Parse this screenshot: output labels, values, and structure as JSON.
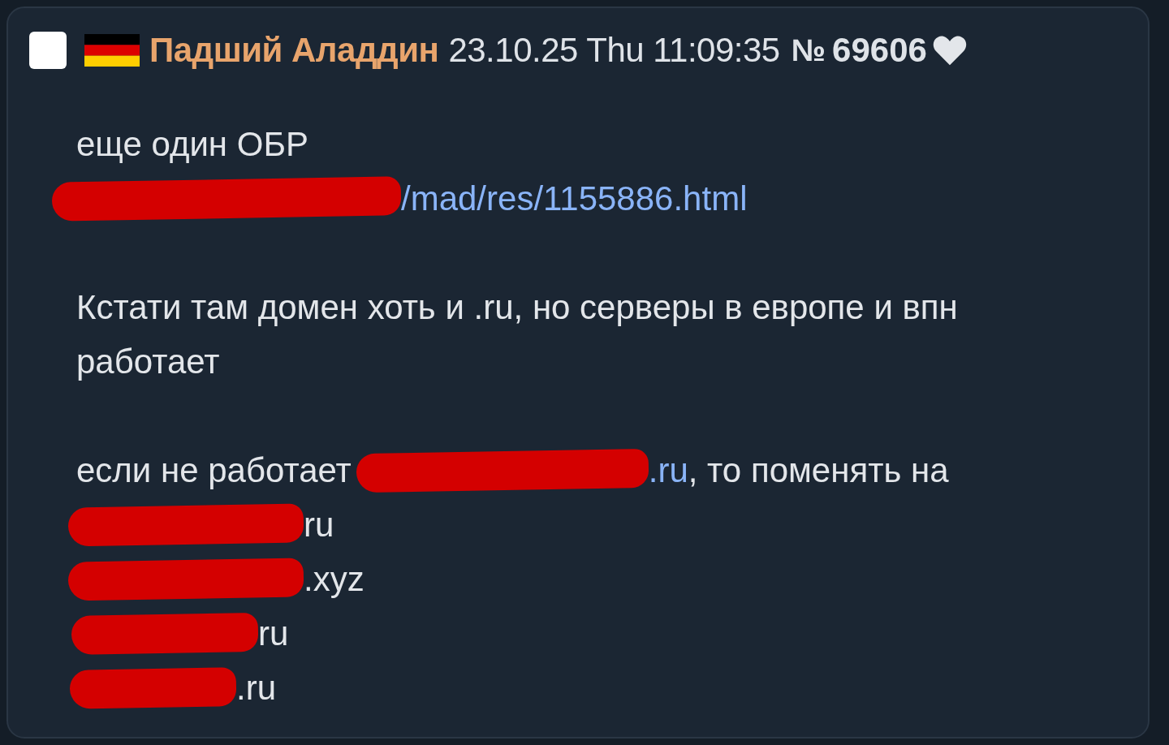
{
  "post": {
    "checkbox": {
      "checked": false
    },
    "author": "Падший Аладдин",
    "date": "23.10.25 Thu 11:09:35",
    "number_sign": "№",
    "number": "69606",
    "paragraphs": [
      [
        [
          {
            "kind": "text",
            "text": "еще один ОБР"
          }
        ],
        [
          {
            "kind": "redaction"
          },
          {
            "kind": "link",
            "text": "/mad/res/1155886.html"
          }
        ]
      ],
      [
        [
          {
            "kind": "text",
            "text": "Кстати там домен хоть и .ru, но серверы в европе и впн работает"
          }
        ]
      ],
      [
        [
          {
            "kind": "text",
            "text": "если не работает"
          },
          {
            "kind": "redaction"
          },
          {
            "kind": "link",
            "text": ".ru"
          },
          {
            "kind": "text",
            "text": ", то поменять на"
          }
        ],
        [
          {
            "kind": "redaction"
          },
          {
            "kind": "text",
            "text": "ru"
          }
        ],
        [
          {
            "kind": "redaction"
          },
          {
            "kind": "text",
            "text": ".xyz"
          }
        ],
        [
          {
            "kind": "redaction"
          },
          {
            "kind": "text",
            "text": "ru"
          }
        ],
        [
          {
            "kind": "redaction"
          },
          {
            "kind": "text",
            "text": ".ru"
          }
        ]
      ]
    ]
  }
}
